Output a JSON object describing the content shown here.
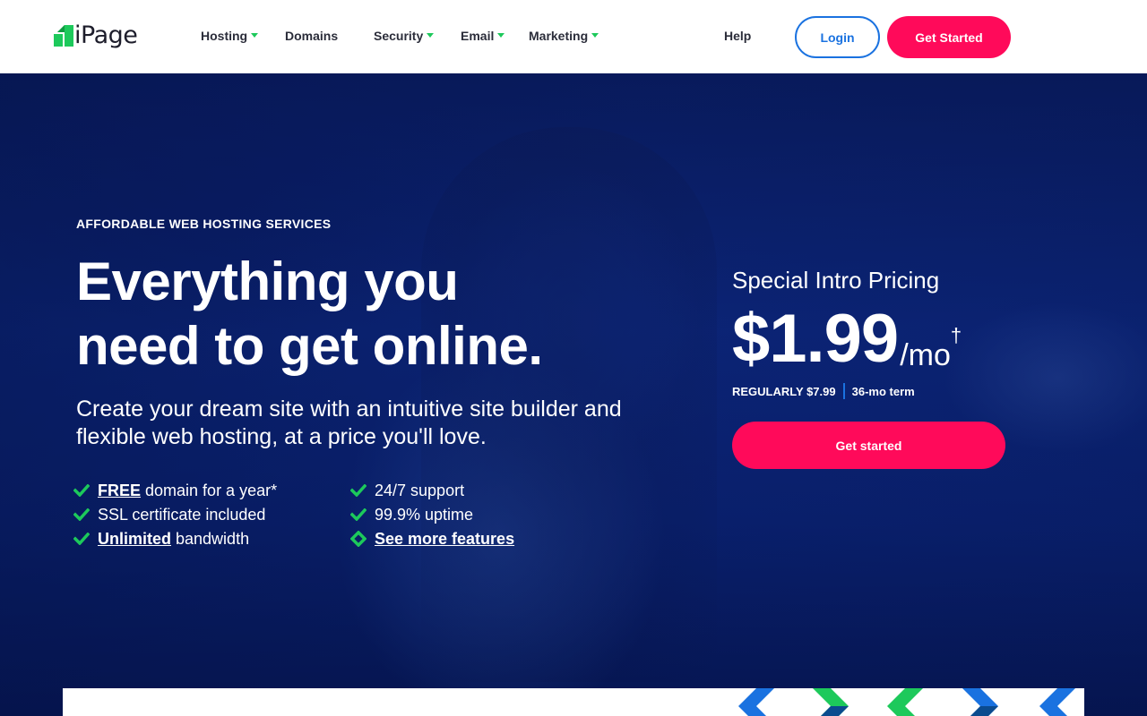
{
  "header": {
    "logo_text": "iPage",
    "nav": [
      {
        "label": "Hosting",
        "has_caret": true
      },
      {
        "label": "Domains",
        "has_caret": false
      },
      {
        "label": "Security",
        "has_caret": true
      },
      {
        "label": "Email",
        "has_caret": true
      },
      {
        "label": "Marketing",
        "has_caret": true
      }
    ],
    "help_label": "Help",
    "login_label": "Login",
    "get_started_label": "Get Started"
  },
  "hero": {
    "eyebrow": "AFFORDABLE WEB HOSTING SERVICES",
    "headline_line1": "Everything you",
    "headline_line2": "need to get online.",
    "subhead": "Create your dream site with an intuitive site builder and flexible web hosting, at a price you'll love.",
    "features": [
      {
        "strong": "FREE",
        "text": "domain for a year*",
        "icon": "check-icon"
      },
      {
        "strong": "",
        "text": "SSL certificate included",
        "icon": "check-icon"
      },
      {
        "strong": "Unlimited",
        "text": "bandwidth",
        "icon": "check-icon"
      },
      {
        "strong": "",
        "text": "24/7 support",
        "icon": "check-icon"
      },
      {
        "strong": "",
        "text": "99.9% uptime",
        "icon": "check-icon"
      },
      {
        "link": "See more features",
        "icon": "diamond-icon"
      }
    ]
  },
  "pricing": {
    "label": "Special Intro Pricing",
    "price": "$1.99",
    "unit": "/mo",
    "dagger": "†",
    "regular": "REGULARLY $7.99",
    "term": "36-mo term",
    "cta_label": "Get started"
  },
  "colors": {
    "brand_green": "#1dc95b",
    "cta_pink": "#ff0a5a",
    "login_blue": "#1a72e0",
    "hero_navy": "#0e2a86"
  }
}
